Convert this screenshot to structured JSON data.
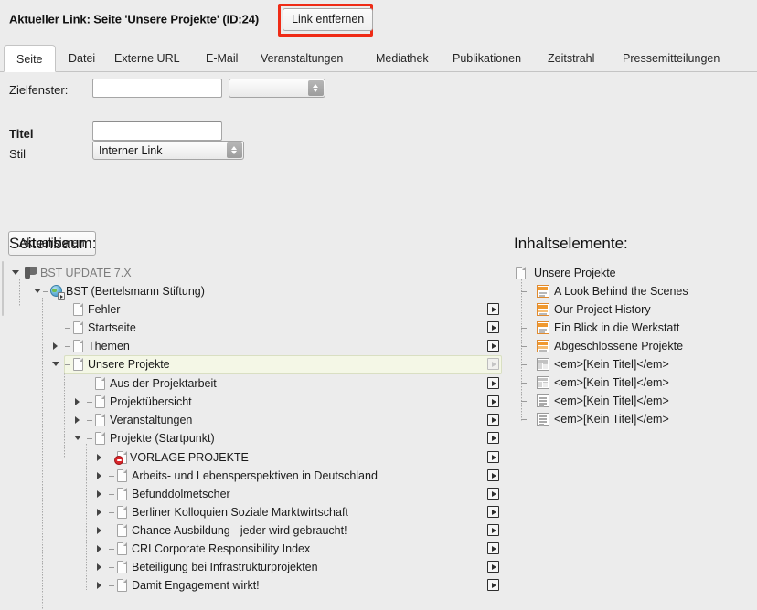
{
  "header": {
    "title": "Aktueller Link: Seite 'Unsere Projekte' (ID:24)",
    "remove_link_label": "Link entfernen",
    "annotation_color": "#ef2b16"
  },
  "tabs": [
    {
      "label": "Seite",
      "active": true
    },
    {
      "label": "Datei",
      "active": false
    },
    {
      "label": "Externe URL",
      "active": false
    },
    {
      "label": "E-Mail",
      "active": false
    },
    {
      "label": "Veranstaltungen",
      "active": false
    },
    {
      "label": "Mediathek",
      "active": false
    },
    {
      "label": "Publikationen",
      "active": false
    },
    {
      "label": "Zeitstrahl",
      "active": false
    },
    {
      "label": "Pressemitteilungen",
      "active": false
    }
  ],
  "form": {
    "target_label": "Zielfenster:",
    "target_value": "",
    "target_placeholder": "",
    "target_select_value": "",
    "title_label": "Titel",
    "title_value": "",
    "title_placeholder": "",
    "style_label": "Stil",
    "style_value": "Interner Link",
    "submit_label": "Aktualisieren"
  },
  "page_tree": {
    "heading": "Seitenbaum:",
    "nodes": [
      {
        "label": "BST UPDATE 7.X",
        "depth": 0,
        "icon": "typo3-root-icon",
        "toggle": "down",
        "dim": true,
        "action": false
      },
      {
        "label": "BST (Bertelsmann Stiftung)",
        "depth": 1,
        "icon": "globe-icon",
        "toggle": "down",
        "dim": false,
        "action": false
      },
      {
        "label": "Fehler",
        "depth": 2,
        "icon": "page-icon",
        "toggle": "none",
        "dim": false,
        "action": true
      },
      {
        "label": "Startseite",
        "depth": 2,
        "icon": "page-icon",
        "toggle": "none",
        "dim": false,
        "action": true
      },
      {
        "label": "Themen",
        "depth": 2,
        "icon": "page-icon",
        "toggle": "right",
        "dim": false,
        "action": true
      },
      {
        "label": "Unsere Projekte",
        "depth": 2,
        "icon": "page-icon",
        "toggle": "down",
        "dim": false,
        "action": true,
        "selected": true
      },
      {
        "label": "Aus der Projektarbeit",
        "depth": 3,
        "icon": "page-icon",
        "toggle": "none",
        "dim": false,
        "action": true
      },
      {
        "label": "Projektübersicht",
        "depth": 3,
        "icon": "page-icon",
        "toggle": "right",
        "dim": false,
        "action": true
      },
      {
        "label": "Veranstaltungen",
        "depth": 3,
        "icon": "page-icon",
        "toggle": "right",
        "dim": false,
        "action": true
      },
      {
        "label": "Projekte (Startpunkt)",
        "depth": 3,
        "icon": "page-icon",
        "toggle": "down",
        "dim": false,
        "action": true
      },
      {
        "label": "VORLAGE PROJEKTE",
        "depth": 4,
        "icon": "page-hidden-icon",
        "toggle": "right",
        "dim": false,
        "action": true
      },
      {
        "label": "Arbeits- und Lebensperspektiven in Deutschland",
        "depth": 4,
        "icon": "page-icon",
        "toggle": "right",
        "dim": false,
        "action": true
      },
      {
        "label": "Befunddolmetscher",
        "depth": 4,
        "icon": "page-icon",
        "toggle": "right",
        "dim": false,
        "action": true
      },
      {
        "label": "Berliner Kolloquien Soziale Marktwirtschaft",
        "depth": 4,
        "icon": "page-icon",
        "toggle": "right",
        "dim": false,
        "action": true
      },
      {
        "label": "Chance Ausbildung - jeder wird gebraucht!",
        "depth": 4,
        "icon": "page-icon",
        "toggle": "right",
        "dim": false,
        "action": true
      },
      {
        "label": "CRI Corporate Responsibility Index",
        "depth": 4,
        "icon": "page-icon",
        "toggle": "right",
        "dim": false,
        "action": true
      },
      {
        "label": "Beteiligung bei Infrastrukturprojekten",
        "depth": 4,
        "icon": "page-icon",
        "toggle": "right",
        "dim": false,
        "action": true
      },
      {
        "label": "Damit Engagement wirkt!",
        "depth": 4,
        "icon": "page-icon",
        "toggle": "right",
        "dim": false,
        "action": true
      }
    ]
  },
  "content_elements": {
    "heading": "Inhaltselemente:",
    "root": {
      "label": "Unsere Projekte",
      "icon": "page-icon"
    },
    "items": [
      {
        "label": "A Look Behind the Scenes",
        "icon": "ce-header-icon"
      },
      {
        "label": "Our Project History",
        "icon": "ce-header-text-icon"
      },
      {
        "label": "Ein Blick in die Werkstatt",
        "icon": "ce-header-icon"
      },
      {
        "label": "Abgeschlossene Projekte",
        "icon": "ce-header-text-icon"
      },
      {
        "label": "<em>[Kein Titel]</em>",
        "icon": "ce-table-icon"
      },
      {
        "label": "<em>[Kein Titel]</em>",
        "icon": "ce-table-icon"
      },
      {
        "label": "<em>[Kein Titel]</em>",
        "icon": "ce-text-icon"
      },
      {
        "label": "<em>[Kein Titel]</em>",
        "icon": "ce-text-icon"
      }
    ]
  }
}
